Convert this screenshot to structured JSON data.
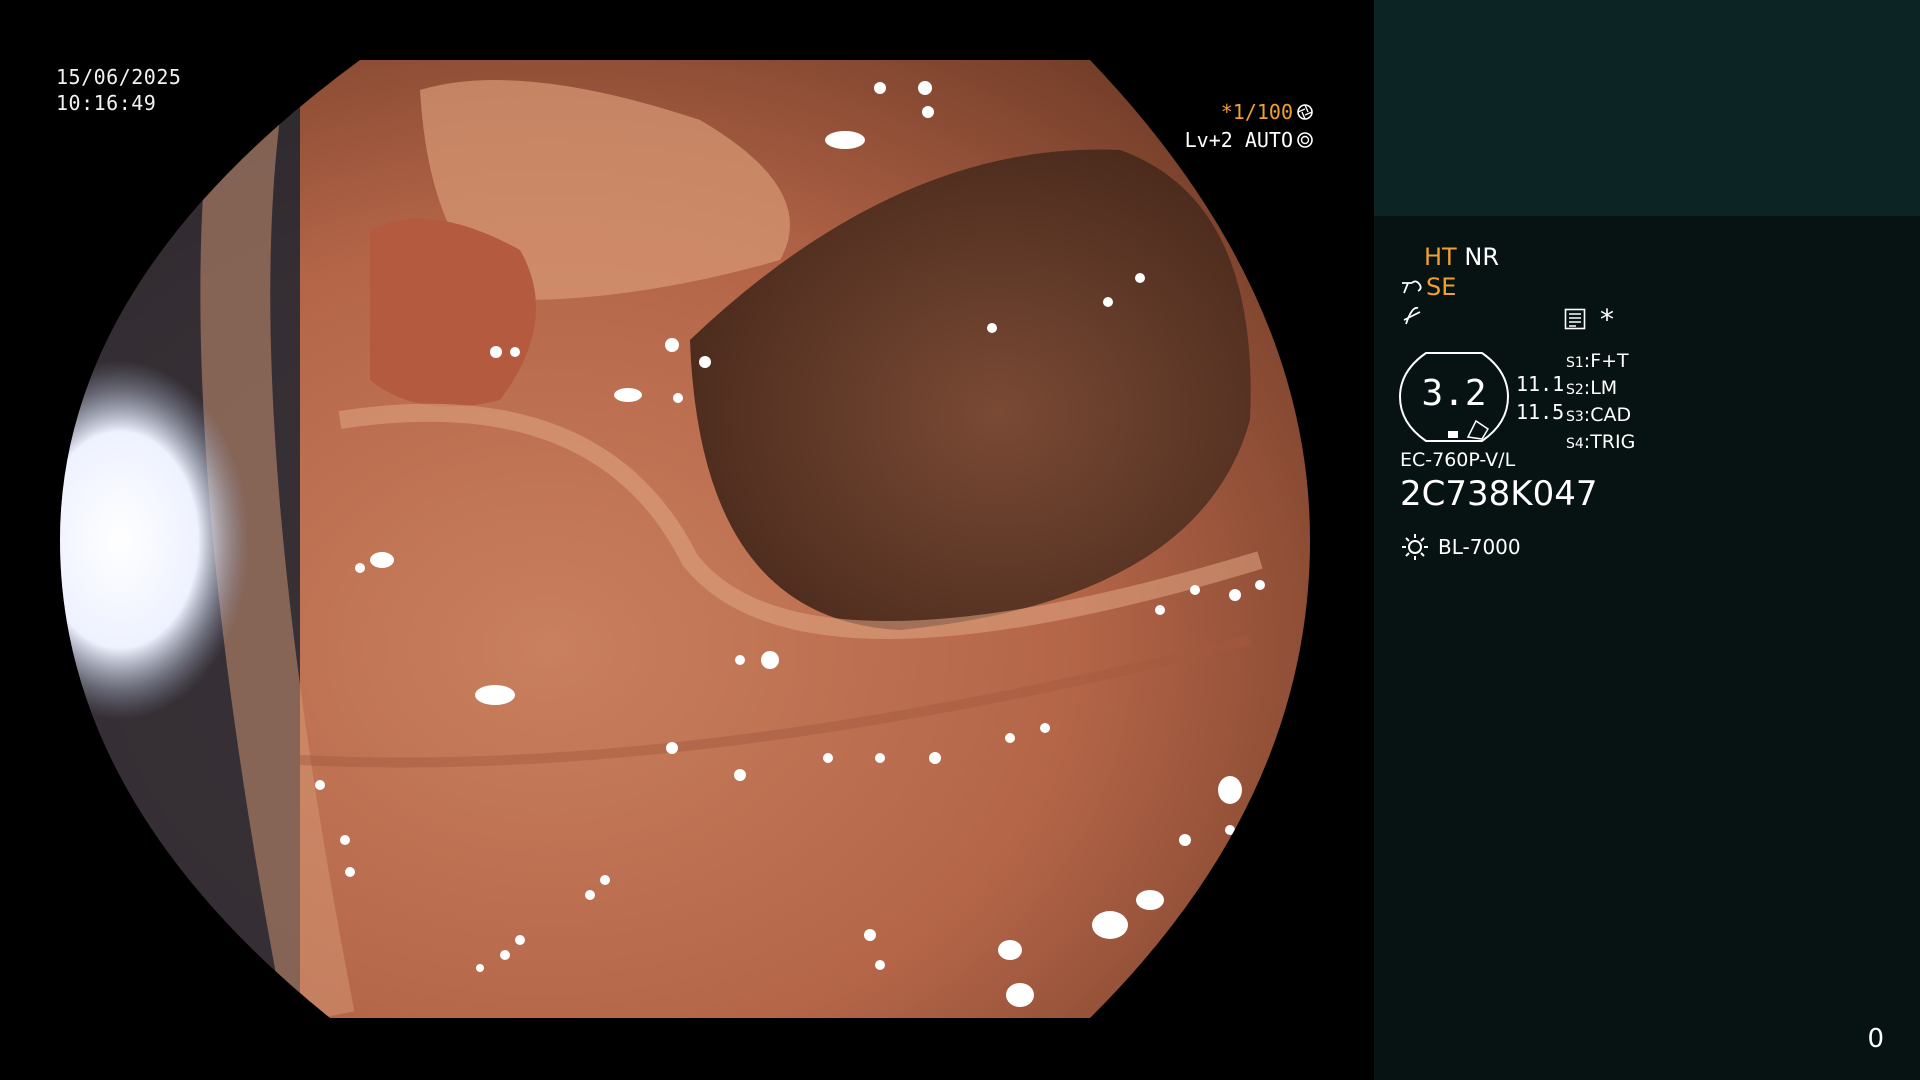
{
  "overlay": {
    "date": "15/06/2025",
    "time": "10:16:49",
    "shutter": "*1/100",
    "level_mode": "Lv+2 AUTO",
    "shutter_icon": "aperture-icon",
    "auto_icon": "iris-icon"
  },
  "panel": {
    "ht_label": "HT",
    "nr_label": "NR",
    "se_label": "SE",
    "asterisk": "*",
    "gauge_value": "3.2",
    "gauge_readings": [
      "11.1",
      "11.5"
    ],
    "switches": [
      {
        "key": "S1",
        "value": "F+T"
      },
      {
        "key": "S2",
        "value": "LM"
      },
      {
        "key": "S3",
        "value": "CAD"
      },
      {
        "key": "S4",
        "value": "TRIG"
      }
    ],
    "scope_model": "EC-760P-V/L",
    "scope_serial": "2C738K047",
    "light_source": "BL-7000",
    "counter": "0",
    "colors": {
      "accent": "#f0a030",
      "panel_bg": "#071312",
      "panel_top": "#0c2424"
    }
  }
}
